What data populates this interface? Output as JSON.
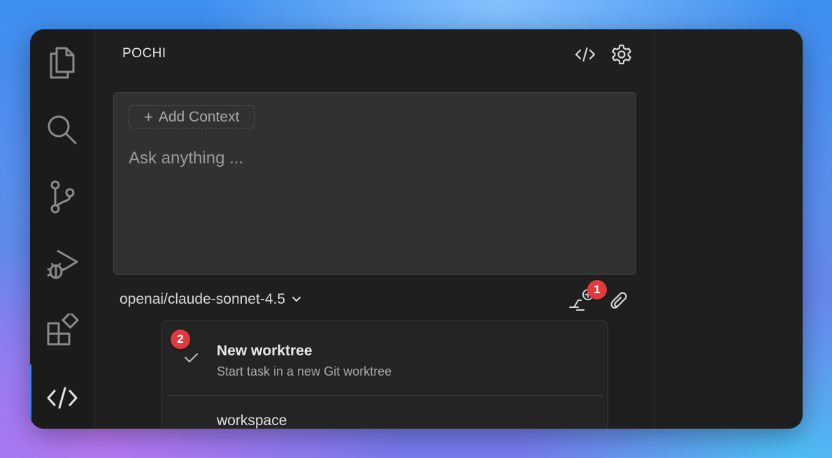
{
  "app": {
    "title": "POCHI"
  },
  "activity_bar": {
    "items": [
      {
        "icon": "files-icon"
      },
      {
        "icon": "search-icon"
      },
      {
        "icon": "source-control-icon"
      },
      {
        "icon": "run-debug-icon"
      },
      {
        "icon": "extensions-icon"
      },
      {
        "icon": "code-icon",
        "active": true
      }
    ]
  },
  "header": {
    "actions": [
      {
        "icon": "code-icon"
      },
      {
        "icon": "gear-icon"
      }
    ]
  },
  "chat": {
    "add_context_label": "Add Context",
    "add_context_icon": "plus-icon",
    "input_placeholder": "Ask anything ..."
  },
  "model_selector": {
    "value": "openai/claude-sonnet-4.5"
  },
  "badges": {
    "first": "1",
    "second": "2"
  },
  "worktree_menu": {
    "items": [
      {
        "title": "New worktree",
        "subtitle": "Start task in a new Git worktree",
        "selected": true
      },
      {
        "title": "workspace",
        "selected": false
      }
    ]
  },
  "colors": {
    "accent": "#3b82f6",
    "badge": "#e03a3e"
  }
}
